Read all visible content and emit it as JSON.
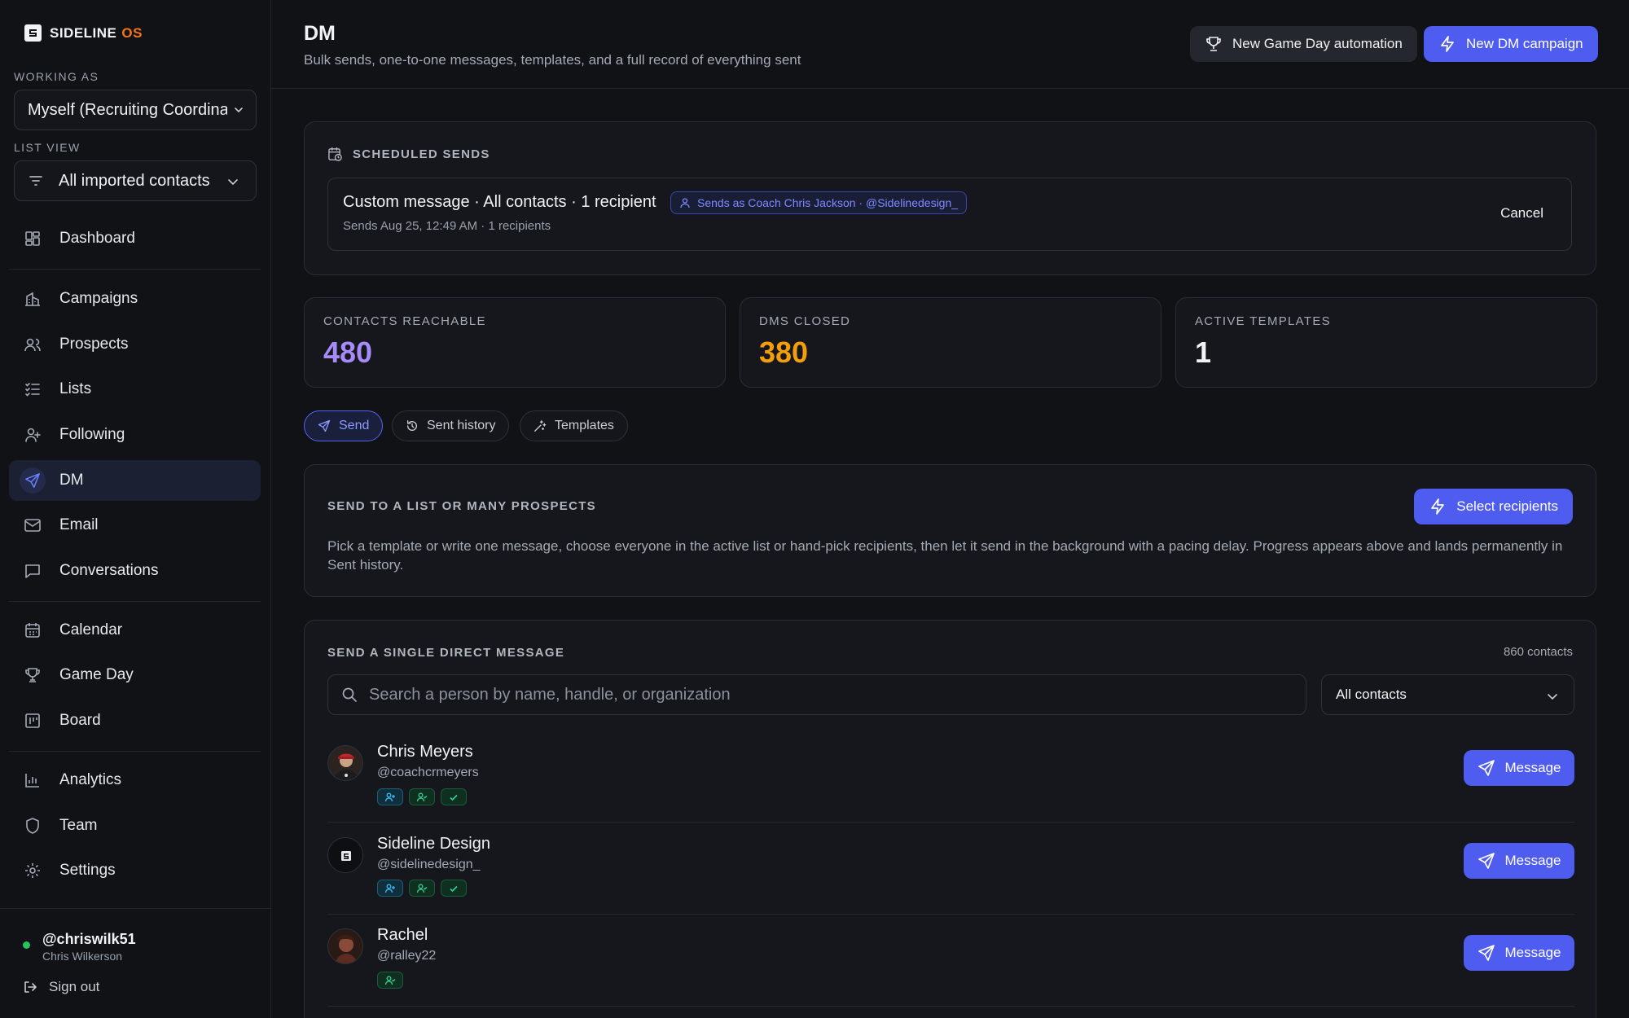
{
  "app": {
    "logo_main": "SIDELINE",
    "logo_accent": "OS"
  },
  "sidebar": {
    "working_as_label": "WORKING AS",
    "working_as_value": "Myself (Recruiting Coordinator)",
    "list_view_label": "LIST VIEW",
    "list_view_value": "All imported contacts",
    "items": [
      {
        "label": "Dashboard",
        "icon": "dashboard-icon"
      },
      {
        "label": "Campaigns",
        "icon": "campaigns-icon"
      },
      {
        "label": "Prospects",
        "icon": "users-icon"
      },
      {
        "label": "Lists",
        "icon": "list-check-icon"
      },
      {
        "label": "Following",
        "icon": "user-plus-icon"
      },
      {
        "label": "DM",
        "icon": "send-icon",
        "active": true
      },
      {
        "label": "Email",
        "icon": "mail-icon"
      },
      {
        "label": "Conversations",
        "icon": "chat-icon"
      },
      {
        "label": "Calendar",
        "icon": "calendar-icon"
      },
      {
        "label": "Game Day",
        "icon": "trophy-icon"
      },
      {
        "label": "Board",
        "icon": "board-icon"
      },
      {
        "label": "Analytics",
        "icon": "bar-chart-icon"
      },
      {
        "label": "Team",
        "icon": "shield-icon"
      },
      {
        "label": "Settings",
        "icon": "gear-icon"
      }
    ],
    "user": {
      "handle": "@chriswilk51",
      "name": "Chris Wilkerson",
      "signout": "Sign out",
      "status_color": "#22c55e"
    }
  },
  "header": {
    "title": "DM",
    "subtitle": "Bulk sends, one-to-one messages, templates, and a full record of everything sent",
    "btn_game_day": "New Game Day automation",
    "btn_dm_campaign": "New DM campaign"
  },
  "scheduled": {
    "heading": "SCHEDULED SENDS",
    "title": "Custom message · All contacts · 1 recipient",
    "badge": "Sends as Coach Chris Jackson · @Sidelinedesign_",
    "meta": "Sends Aug 25, 12:49 AM · 1 recipients",
    "cancel": "Cancel"
  },
  "stats": [
    {
      "label": "CONTACTS REACHABLE",
      "value": "480",
      "color": "#a78bfa"
    },
    {
      "label": "DMS CLOSED",
      "value": "380",
      "color": "#f59e0b"
    },
    {
      "label": "ACTIVE TEMPLATES",
      "value": "1",
      "color": "#f2f3f5"
    }
  ],
  "tabs": [
    {
      "label": "Send",
      "active": true
    },
    {
      "label": "Sent history"
    },
    {
      "label": "Templates"
    }
  ],
  "bulk": {
    "heading": "SEND TO A LIST OR MANY PROSPECTS",
    "button": "Select recipients",
    "description": "Pick a template or write one message, choose everyone in the active list or hand-pick recipients, then let it send in the background with a pacing delay. Progress appears above and lands permanently in Sent history."
  },
  "single": {
    "heading": "SEND A SINGLE DIRECT MESSAGE",
    "count": "860 contacts",
    "search_placeholder": "Search a person by name, handle, or organization",
    "filter_value": "All contacts",
    "message_label": "Message",
    "people": [
      {
        "name": "Chris Meyers",
        "handle": "@coachcrmeyers",
        "chips": [
          "follow",
          "follower",
          "connected"
        ]
      },
      {
        "name": "Sideline Design",
        "handle": "@sidelinedesign_",
        "chips": [
          "follow",
          "follower",
          "connected"
        ]
      },
      {
        "name": "Rachel",
        "handle": "@ralley22",
        "chips": [
          "follower"
        ]
      }
    ]
  },
  "colors": {
    "accent": "#4f5cf0",
    "background": "#101216",
    "card": "#15171c"
  }
}
